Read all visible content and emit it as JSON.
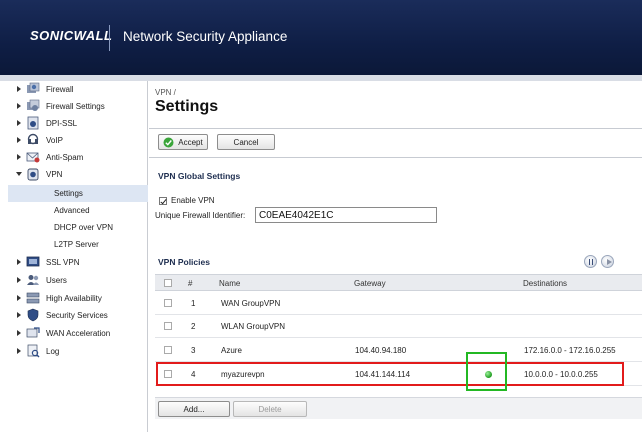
{
  "header": {
    "logo": "SONICWALL",
    "product": "Network Security Appliance"
  },
  "sidebar": {
    "items": [
      {
        "label": "Firewall",
        "icon": "firewall-icon",
        "expanded": false
      },
      {
        "label": "Firewall Settings",
        "icon": "firewall-settings-icon",
        "expanded": false
      },
      {
        "label": "DPI-SSL",
        "icon": "dpi-ssl-icon",
        "expanded": false
      },
      {
        "label": "VoIP",
        "icon": "voip-icon",
        "expanded": false
      },
      {
        "label": "Anti-Spam",
        "icon": "anti-spam-icon",
        "expanded": false
      },
      {
        "label": "VPN",
        "icon": "vpn-icon",
        "expanded": true
      },
      {
        "label": "SSL VPN",
        "icon": "ssl-vpn-icon",
        "expanded": false
      },
      {
        "label": "Users",
        "icon": "users-icon",
        "expanded": false
      },
      {
        "label": "High Availability",
        "icon": "high-availability-icon",
        "expanded": false
      },
      {
        "label": "Security Services",
        "icon": "security-services-icon",
        "expanded": false
      },
      {
        "label": "WAN Acceleration",
        "icon": "wan-acceleration-icon",
        "expanded": false
      },
      {
        "label": "Log",
        "icon": "log-icon",
        "expanded": false
      }
    ],
    "vpn_subitems": [
      {
        "label": "Settings",
        "active": true
      },
      {
        "label": "Advanced",
        "active": false
      },
      {
        "label": "DHCP over VPN",
        "active": false
      },
      {
        "label": "L2TP Server",
        "active": false
      }
    ]
  },
  "main": {
    "breadcrumb": "VPN /",
    "title": "Settings",
    "accept_label": "Accept",
    "cancel_label": "Cancel",
    "global_settings_title": "VPN Global Settings",
    "enable_vpn_label": "Enable VPN",
    "enable_vpn_checked": true,
    "firewall_id_label": "Unique Firewall Identifier:",
    "firewall_id_value": "C0EAE4042E1C",
    "policies_title": "VPN Policies",
    "table": {
      "columns": [
        "#",
        "Name",
        "Gateway",
        "Destinations"
      ],
      "rows": [
        {
          "num": "1",
          "name": "WAN GroupVPN",
          "gateway": "",
          "destinations": "",
          "status": false
        },
        {
          "num": "2",
          "name": "WLAN GroupVPN",
          "gateway": "",
          "destinations": "",
          "status": false
        },
        {
          "num": "3",
          "name": "Azure",
          "gateway": "104.40.94.180",
          "destinations": "172.16.0.0 - 172.16.0.255",
          "status": false
        },
        {
          "num": "4",
          "name": "myazurevpn",
          "gateway": "104.41.144.114",
          "destinations": "10.0.0.0 - 10.0.0.255",
          "status": true
        }
      ]
    },
    "add_label": "Add...",
    "delete_label": "Delete"
  },
  "colors": {
    "header_bg": "#0f1e45",
    "highlight_red": "#e21b1b",
    "highlight_green": "#23b823",
    "status_green": "#1f9b1f"
  }
}
